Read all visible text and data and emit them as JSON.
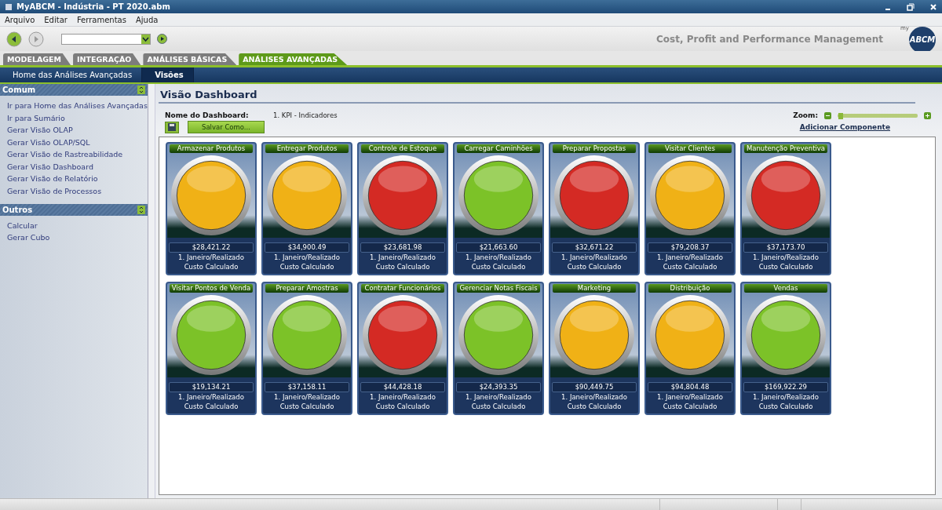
{
  "window": {
    "title": "MyABCM  - Indústria - PT 2020.abm"
  },
  "menu": [
    "Arquivo",
    "Editar",
    "Ferramentas",
    "Ajuda"
  ],
  "toolbar": {
    "tagline": "Cost, Profit and Performance Management",
    "logo": {
      "prefix": "my",
      "text": "ABCM"
    }
  },
  "tabs": [
    {
      "label": "MODELAGEM",
      "selected": false
    },
    {
      "label": "INTEGRAÇÃO",
      "selected": false
    },
    {
      "label": "ANÁLISES BÁSICAS",
      "selected": false
    },
    {
      "label": "ANÁLISES AVANÇADAS",
      "selected": true
    }
  ],
  "subnav": [
    {
      "label": "Home das Análises Avançadas",
      "selected": false
    },
    {
      "label": "Visões",
      "selected": true
    }
  ],
  "sidebar": [
    {
      "title": "Comum",
      "items": [
        "Ir para Home das Análises Avançadas",
        "Ir para Sumário",
        "Gerar Visão OLAP",
        "Gerar Visão OLAP/SQL",
        "Gerar Visão de Rastreabilidade",
        "Gerar Visão Dashboard",
        "Gerar Visão de Relatório",
        "Gerar Visão de Processos"
      ]
    },
    {
      "title": "Outros",
      "items": [
        "Calcular",
        "Gerar Cubo"
      ]
    }
  ],
  "main": {
    "title": "Visão Dashboard",
    "name_label": "Nome do Dashboard:",
    "name_value": "1. KPI - Indicadores",
    "save_as": "Salvar Como...",
    "zoom": {
      "label": "Zoom:",
      "level": 0.04
    },
    "add_component": "Adicionar Componente"
  },
  "indicators": [
    {
      "title": "Armazenar Produtos",
      "color": "#f0b116",
      "value": "$28,421.22",
      "period": "1. Janeiro/Realizado",
      "measure": "Custo Calculado"
    },
    {
      "title": "Entregar Produtos",
      "color": "#f0b116",
      "value": "$34,900.49",
      "period": "1. Janeiro/Realizado",
      "measure": "Custo Calculado"
    },
    {
      "title": "Controle de Estoque",
      "color": "#d42a24",
      "value": "$23,681.98",
      "period": "1. Janeiro/Realizado",
      "measure": "Custo Calculado"
    },
    {
      "title": "Carregar Caminhões",
      "color": "#7cc228",
      "value": "$21,663.60",
      "period": "1. Janeiro/Realizado",
      "measure": "Custo Calculado"
    },
    {
      "title": "Preparar Propostas",
      "color": "#d42a24",
      "value": "$32,671.22",
      "period": "1. Janeiro/Realizado",
      "measure": "Custo Calculado"
    },
    {
      "title": "Visitar Clientes",
      "color": "#f0b116",
      "value": "$79,208.37",
      "period": "1. Janeiro/Realizado",
      "measure": "Custo Calculado"
    },
    {
      "title": "Manutenção Preventiva",
      "color": "#d42a24",
      "value": "$37,173.70",
      "period": "1. Janeiro/Realizado",
      "measure": "Custo Calculado"
    },
    {
      "title": "Visitar Pontos de Venda",
      "color": "#7cc228",
      "value": "$19,134.21",
      "period": "1. Janeiro/Realizado",
      "measure": "Custo Calculado"
    },
    {
      "title": "Preparar Amostras",
      "color": "#7cc228",
      "value": "$37,158.11",
      "period": "1. Janeiro/Realizado",
      "measure": "Custo Calculado"
    },
    {
      "title": "Contratar Funcionários",
      "color": "#d42a24",
      "value": "$44,428.18",
      "period": "1. Janeiro/Realizado",
      "measure": "Custo Calculado"
    },
    {
      "title": "Gerenciar Notas Fiscais",
      "color": "#7cc228",
      "value": "$24,393.35",
      "period": "1. Janeiro/Realizado",
      "measure": "Custo Calculado"
    },
    {
      "title": "Marketing",
      "color": "#f0b116",
      "value": "$90,449.75",
      "period": "1. Janeiro/Realizado",
      "measure": "Custo Calculado"
    },
    {
      "title": "Distribuição",
      "color": "#f0b116",
      "value": "$94,804.48",
      "period": "1. Janeiro/Realizado",
      "measure": "Custo Calculado"
    },
    {
      "title": "Vendas",
      "color": "#7cc228",
      "value": "$169,922.29",
      "period": "1. Janeiro/Realizado",
      "measure": "Custo Calculado"
    }
  ]
}
